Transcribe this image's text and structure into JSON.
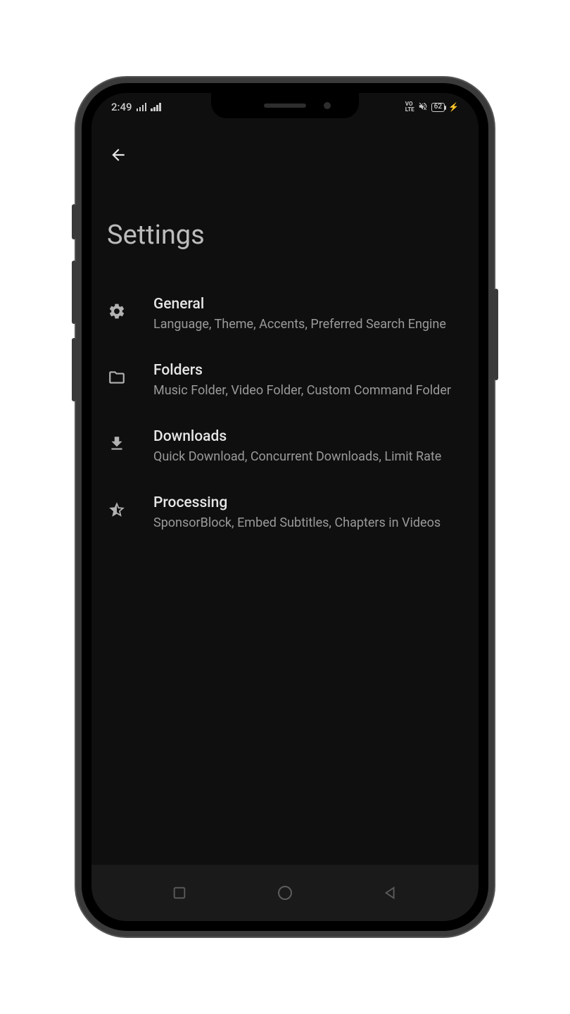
{
  "status": {
    "time": "2:49",
    "network_label": "LTE",
    "battery": "62"
  },
  "page": {
    "title": "Settings"
  },
  "items": [
    {
      "icon": "gear",
      "title": "General",
      "subtitle": "Language, Theme, Accents, Preferred Search Engine"
    },
    {
      "icon": "folder",
      "title": "Folders",
      "subtitle": "Music Folder, Video Folder, Custom Command Folder"
    },
    {
      "icon": "download",
      "title": "Downloads",
      "subtitle": "Quick Download, Concurrent Downloads, Limit Rate"
    },
    {
      "icon": "star-half",
      "title": "Processing",
      "subtitle": "SponsorBlock, Embed Subtitles, Chapters in Videos"
    }
  ]
}
